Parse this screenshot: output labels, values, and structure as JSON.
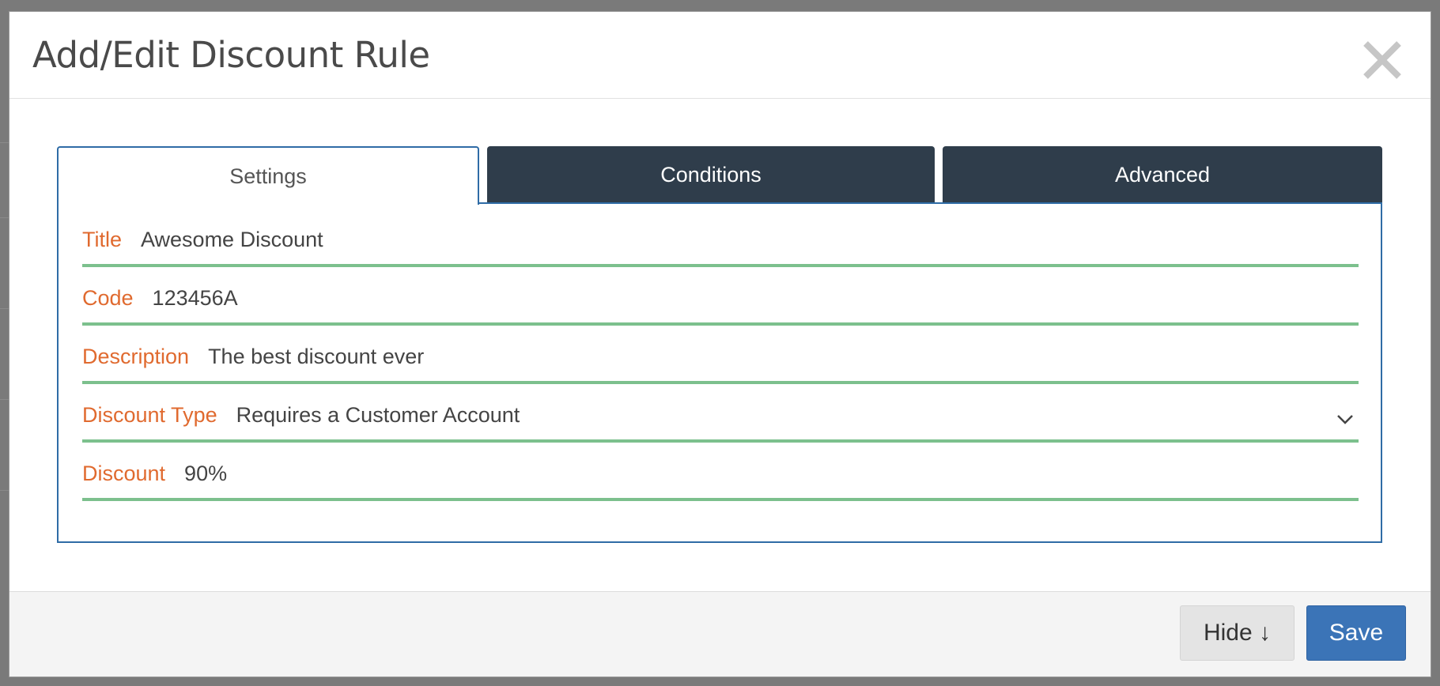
{
  "dialog": {
    "title": "Add/Edit Discount Rule",
    "close_icon": "close-icon"
  },
  "tabs": [
    {
      "label": "Settings",
      "active": true
    },
    {
      "label": "Conditions",
      "active": false
    },
    {
      "label": "Advanced",
      "active": false
    }
  ],
  "form": {
    "title": {
      "label": "Title",
      "value": "Awesome Discount"
    },
    "code": {
      "label": "Code",
      "value": "123456A"
    },
    "description": {
      "label": "Description",
      "value": "The best discount ever"
    },
    "discount_type": {
      "label": "Discount Type",
      "value": "Requires a Customer Account",
      "icon": "chevron-down-icon"
    },
    "discount": {
      "label": "Discount",
      "value": "90%"
    }
  },
  "footer": {
    "hide_label": "Hide ↓",
    "save_label": "Save"
  },
  "colors": {
    "label_orange": "#e06a2f",
    "underline_green": "#7cc08d",
    "tab_dark": "#2f3d4b",
    "accent_blue": "#2f6ca6",
    "save_blue": "#3b74b7"
  }
}
